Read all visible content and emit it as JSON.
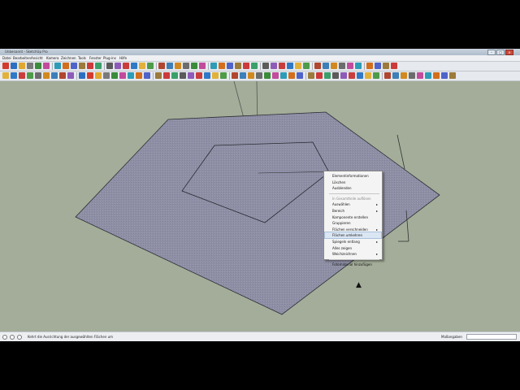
{
  "window": {
    "title": "Unbenannt - SketchUp Pro",
    "controls": [
      "–",
      "□",
      "×"
    ]
  },
  "menubar": [
    "Datei",
    "Bearbeiten",
    "Ansicht",
    "Kamera",
    "Zeichnen",
    "Tools",
    "Fenster",
    "Plug-ins",
    "Hilfe"
  ],
  "toolbar": {
    "row1_colors": [
      "#d23b2e",
      "#2c6fc2",
      "#e0a82e",
      "#7a7a7a",
      "#3b8c3a",
      "#c24b9c",
      "#2d9cb7",
      "#d26e1c",
      "#4f63c9",
      "#9b7a3b",
      "#cc3a3a",
      "#3aa06a",
      "#5b5b5b",
      "#8e5bb8",
      "#c93d3d",
      "#2f79c7",
      "#e1b13a",
      "#4e9b4a",
      "#b0462f",
      "#3d7fb8",
      "#d1891f",
      "#6c6c6c",
      "#3b8c3a",
      "#c24b9c",
      "#2d9cb7",
      "#d26e1c",
      "#4f63c9",
      "#9b7a3b",
      "#cc3a3a",
      "#3aa06a",
      "#5b5b5b",
      "#8e5bb8",
      "#c93d3d",
      "#2f79c7",
      "#e1b13a",
      "#4e9b4a",
      "#b0462f",
      "#3d7fb8",
      "#d1891f",
      "#6c6c6c",
      "#c24b9c",
      "#2d9cb7",
      "#d26e1c",
      "#4f63c9",
      "#9b7a3b",
      "#cc3a3a"
    ],
    "row2_colors": [
      "#e1b13a",
      "#2f79c7",
      "#c93d3d",
      "#4e9b4a",
      "#6c6c6c",
      "#d1891f",
      "#3d7fb8",
      "#b0462f",
      "#8e5bb8",
      "#2c6fc2",
      "#d23b2e",
      "#e0a82e",
      "#7a7a7a",
      "#3b8c3a",
      "#c24b9c",
      "#2d9cb7",
      "#d26e1c",
      "#4f63c9",
      "#9b7a3b",
      "#cc3a3a",
      "#3aa06a",
      "#5b5b5b",
      "#8e5bb8",
      "#c93d3d",
      "#2f79c7",
      "#e1b13a",
      "#4e9b4a",
      "#b0462f",
      "#3d7fb8",
      "#d1891f",
      "#6c6c6c",
      "#3b8c3a",
      "#c24b9c",
      "#2d9cb7",
      "#d26e1c",
      "#4f63c9",
      "#9b7a3b",
      "#cc3a3a",
      "#3aa06a",
      "#5b5b5b",
      "#8e5bb8",
      "#c93d3d",
      "#2f79c7",
      "#e1b13a",
      "#4e9b4a",
      "#b0462f",
      "#3d7fb8",
      "#d1891f",
      "#6c6c6c",
      "#c24b9c",
      "#2d9cb7",
      "#d26e1c",
      "#4f63c9",
      "#9b7a3b"
    ]
  },
  "colors": {
    "viewport_bg": "#a3ad99",
    "face_fill": "#8e8fa5",
    "face_edge": "#2b2b33",
    "context_highlight": "#dbe6f3"
  },
  "context_menu": {
    "items": [
      {
        "label": "Elementinformationen",
        "submenu": false,
        "disabled": false,
        "highlighted": false
      },
      {
        "label": "Löschen",
        "submenu": false,
        "disabled": false,
        "highlighted": false
      },
      {
        "label": "Ausblenden",
        "submenu": false,
        "disabled": false,
        "highlighted": false
      },
      {
        "separator": true
      },
      {
        "label": "In Gesamtteile auflösen",
        "submenu": false,
        "disabled": true,
        "highlighted": false
      },
      {
        "label": "Auswählen",
        "submenu": true,
        "disabled": false,
        "highlighted": false
      },
      {
        "label": "Bereich",
        "submenu": true,
        "disabled": false,
        "highlighted": false
      },
      {
        "label": "Komponente erstellen",
        "submenu": false,
        "disabled": false,
        "highlighted": false
      },
      {
        "label": "Gruppieren",
        "submenu": false,
        "disabled": false,
        "highlighted": false
      },
      {
        "label": "Flächen verschneiden",
        "submenu": true,
        "disabled": false,
        "highlighted": false
      },
      {
        "label": "Flächen umkehren",
        "submenu": false,
        "disabled": false,
        "highlighted": true
      },
      {
        "label": "Spiegeln entlang",
        "submenu": true,
        "disabled": false,
        "highlighted": false
      },
      {
        "label": "Alles zeigen",
        "submenu": false,
        "disabled": false,
        "highlighted": false
      },
      {
        "label": "Weichzeichnen",
        "submenu": true,
        "disabled": false,
        "highlighted": false
      },
      {
        "separator": true
      },
      {
        "label": "Fotomaterial hinzufügen",
        "submenu": false,
        "disabled": false,
        "highlighted": false
      }
    ]
  },
  "statusbar": {
    "hint": "Kehrt die Ausrichtung der ausgewählten Flächen um",
    "measurements_label": "Maßangaben",
    "measurements_value": ""
  }
}
